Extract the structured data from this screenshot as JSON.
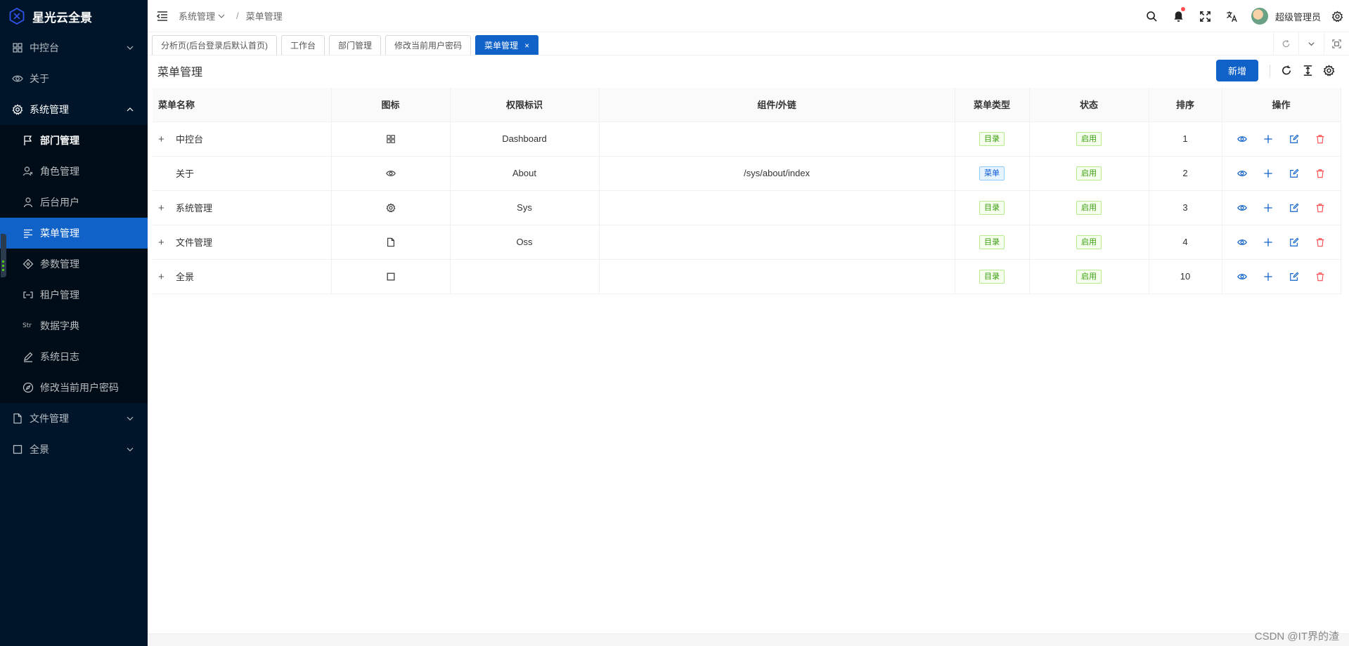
{
  "app": {
    "title": "星光云全景"
  },
  "colors": {
    "primary": "#1062c9",
    "sidebar_bg": "#001529",
    "tag_green": "#389e0d",
    "tag_blue": "#0958d9",
    "danger": "#ff4d4f"
  },
  "sidebar": {
    "items": [
      {
        "label": "中控台",
        "icon": "dashboard-icon"
      },
      {
        "label": "关于",
        "icon": "eye-icon"
      },
      {
        "label": "系统管理",
        "icon": "gear-icon"
      }
    ],
    "system_children": [
      {
        "label": "部门管理",
        "icon": "flag-icon"
      },
      {
        "label": "角色管理",
        "icon": "role-icon"
      },
      {
        "label": "后台用户",
        "icon": "user-icon"
      },
      {
        "label": "菜单管理",
        "icon": "menu-list-icon"
      },
      {
        "label": "参数管理",
        "icon": "param-icon"
      },
      {
        "label": "租户管理",
        "icon": "tenant-icon"
      },
      {
        "label": "数据字典",
        "icon": "string-icon",
        "glyph": "Str"
      },
      {
        "label": "系统日志",
        "icon": "pen-icon"
      },
      {
        "label": "修改当前用户密码",
        "icon": "compass-icon"
      }
    ],
    "bottom_items": [
      {
        "label": "文件管理",
        "icon": "file-icon"
      },
      {
        "label": "全景",
        "icon": "square-icon"
      }
    ]
  },
  "header": {
    "breadcrumb": [
      "系统管理",
      "菜单管理"
    ],
    "breadcrumb_sep": "/",
    "user_name": "超级管理员"
  },
  "tabs": [
    {
      "label": "分析页(后台登录后默认首页)"
    },
    {
      "label": "工作台"
    },
    {
      "label": "部门管理"
    },
    {
      "label": "修改当前用户密码"
    },
    {
      "label": "菜单管理",
      "active": true,
      "close": "×"
    }
  ],
  "page": {
    "title": "菜单管理",
    "add_label": "新增"
  },
  "table": {
    "columns": [
      "菜单名称",
      "图标",
      "权限标识",
      "组件/外链",
      "菜单类型",
      "状态",
      "排序",
      "操作"
    ],
    "rows": [
      {
        "expander": "+",
        "name": "中控台",
        "icon": "dashboard-icon",
        "perm": "Dashboard",
        "component": "",
        "type": "目录",
        "status": "启用",
        "sort": "1"
      },
      {
        "expander": "",
        "name": "关于",
        "icon": "eye-icon",
        "perm": "About",
        "component": "/sys/about/index",
        "type": "菜单",
        "status": "启用",
        "sort": "2"
      },
      {
        "expander": "+",
        "name": "系统管理",
        "icon": "gear-icon",
        "perm": "Sys",
        "component": "",
        "type": "目录",
        "status": "启用",
        "sort": "3"
      },
      {
        "expander": "+",
        "name": "文件管理",
        "icon": "file-icon",
        "perm": "Oss",
        "component": "",
        "type": "目录",
        "status": "启用",
        "sort": "4"
      },
      {
        "expander": "+",
        "name": "全景",
        "icon": "square-icon",
        "perm": "",
        "component": "",
        "type": "目录",
        "status": "启用",
        "sort": "10"
      }
    ]
  },
  "watermark": "CSDN @IT界的渣"
}
